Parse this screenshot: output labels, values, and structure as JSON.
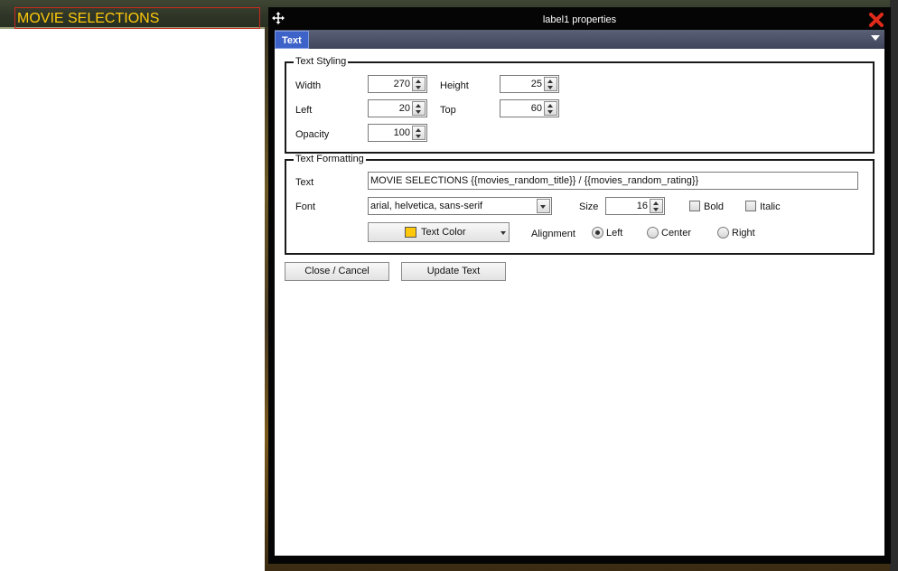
{
  "canvas": {
    "label_text": "MOVIE SELECTIONS"
  },
  "dialog": {
    "title": "label1 properties",
    "tab": "Text"
  },
  "text_styling": {
    "legend": "Text Styling",
    "width_label": "Width",
    "width_value": "270",
    "height_label": "Height",
    "height_value": "25",
    "left_label": "Left",
    "left_value": "20",
    "top_label": "Top",
    "top_value": "60",
    "opacity_label": "Opacity",
    "opacity_value": "100"
  },
  "text_formatting": {
    "legend": "Text Formatting",
    "text_label": "Text",
    "text_value": "MOVIE SELECTIONS {{movies_random_title}} / {{movies_random_rating}}",
    "font_label": "Font",
    "font_value": "arial, helvetica, sans-serif",
    "size_label": "Size",
    "size_value": "16",
    "bold_label": "Bold",
    "italic_label": "Italic",
    "color_button_label": "Text Color",
    "text_color": "#ffc80a",
    "alignment_label": "Alignment",
    "align_left_label": "Left",
    "align_center_label": "Center",
    "align_right_label": "Right",
    "alignment_selected": "Left"
  },
  "buttons": {
    "close_cancel": "Close / Cancel",
    "update_text": "Update Text"
  }
}
